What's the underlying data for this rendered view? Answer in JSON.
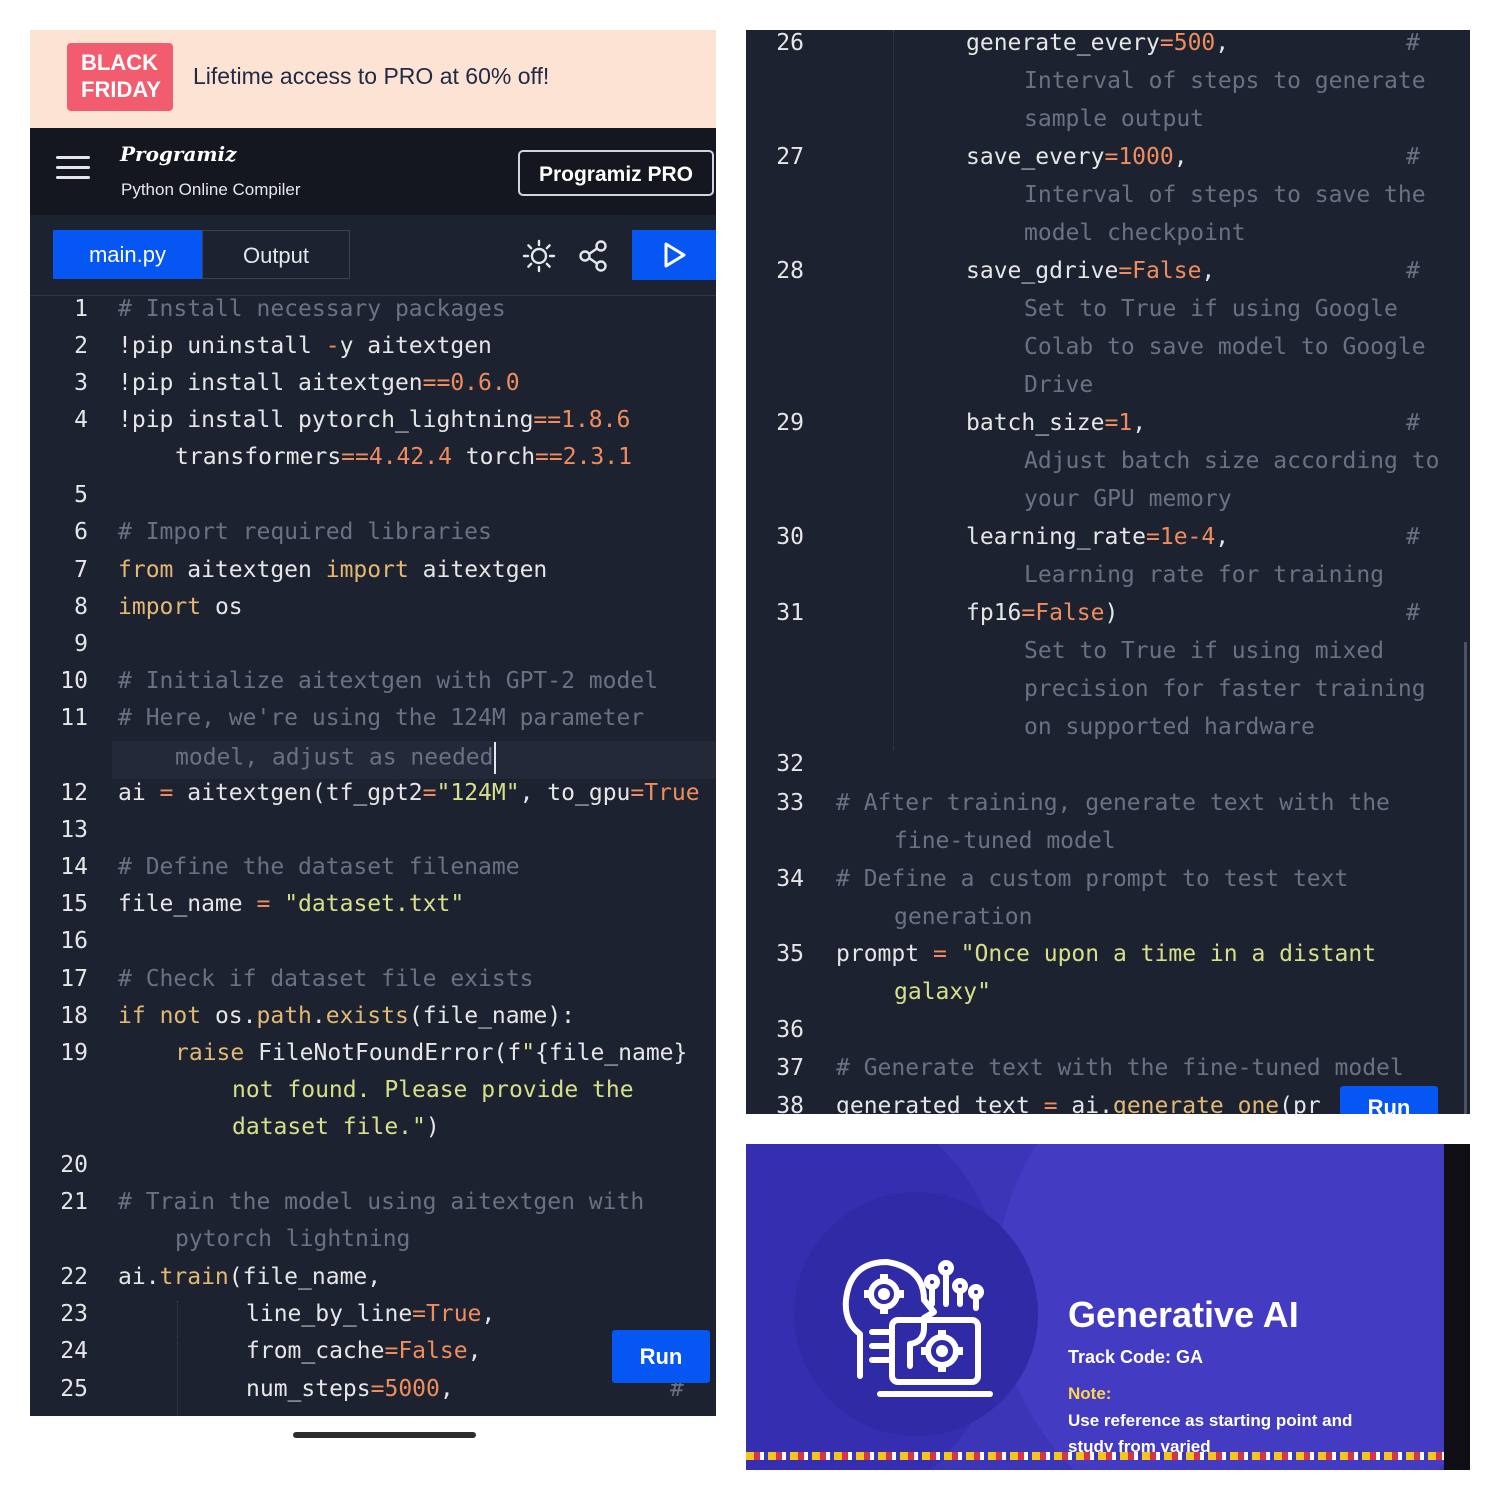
{
  "promo": {
    "badge_line1": "BLACK",
    "badge_line2": "FRIDAY",
    "text": "Lifetime access to PRO at 60% off!"
  },
  "header": {
    "brand": "Programiz",
    "subtitle": "Python Online Compiler",
    "pro_button": "Programiz PRO"
  },
  "tabs": {
    "main": "main.py",
    "output": "Output"
  },
  "icons": {
    "menu": "hamburger-menu-icon",
    "theme": "sun-icon",
    "share": "share-icon",
    "run": "play-icon"
  },
  "left_code": {
    "run_button": "Run",
    "lines": [
      {
        "n": "1",
        "text": "# Install necessary packages"
      },
      {
        "n": "2",
        "text": "!pip uninstall -y aitextgen"
      },
      {
        "n": "3",
        "text": "!pip install aitextgen==0.6.0"
      },
      {
        "n": "4",
        "text": "!pip install pytorch_lightning==1.8.6 transformers==4.42.4 torch==2.3.1"
      },
      {
        "n": "5",
        "text": ""
      },
      {
        "n": "6",
        "text": "# Import required libraries"
      },
      {
        "n": "7",
        "text": "from aitextgen import aitextgen"
      },
      {
        "n": "8",
        "text": "import os"
      },
      {
        "n": "9",
        "text": ""
      },
      {
        "n": "10",
        "text": "# Initialize aitextgen with GPT-2 model"
      },
      {
        "n": "11",
        "text": "# Here, we're using the 124M parameter model, adjust as needed"
      },
      {
        "n": "12",
        "text": "ai = aitextgen(tf_gpt2=\"124M\", to_gpu=True"
      },
      {
        "n": "13",
        "text": ""
      },
      {
        "n": "14",
        "text": "# Define the dataset filename"
      },
      {
        "n": "15",
        "text": "file_name = \"dataset.txt\""
      },
      {
        "n": "16",
        "text": ""
      },
      {
        "n": "17",
        "text": "# Check if dataset file exists"
      },
      {
        "n": "18",
        "text": "if not os.path.exists(file_name):"
      },
      {
        "n": "19",
        "text": "raise FileNotFoundError(f\"{file_name} not found. Please provide the dataset file.\")"
      },
      {
        "n": "20",
        "text": ""
      },
      {
        "n": "21",
        "text": "# Train the model using aitextgen with pytorch lightning"
      },
      {
        "n": "22",
        "text": "ai.train(file_name,"
      },
      {
        "n": "23",
        "text": "line_by_line=True,"
      },
      {
        "n": "24",
        "text": "from_cache=False,"
      },
      {
        "n": "25",
        "text": "num_steps=5000,"
      }
    ]
  },
  "right_code": {
    "run_button": "Run",
    "lines": [
      {
        "n": "26",
        "text": "generate_every=500, # Interval of steps to generate sample output"
      },
      {
        "n": "27",
        "text": "save_every=1000, # Interval of steps to save the model checkpoint"
      },
      {
        "n": "28",
        "text": "save_gdrive=False, # Set to True if using Google Colab to save model to Google Drive"
      },
      {
        "n": "29",
        "text": "batch_size=1, # Adjust batch size according to your GPU memory"
      },
      {
        "n": "30",
        "text": "learning_rate=1e-4, # Learning rate for training"
      },
      {
        "n": "31",
        "text": "fp16=False) # Set to True if using mixed precision for faster training on supported hardware"
      },
      {
        "n": "32",
        "text": ""
      },
      {
        "n": "33",
        "text": "# After training, generate text with the fine-tuned model"
      },
      {
        "n": "34",
        "text": "# Define a custom prompt to test text generation"
      },
      {
        "n": "35",
        "text": "prompt = \"Once upon a time in a distant galaxy\""
      },
      {
        "n": "36",
        "text": ""
      },
      {
        "n": "37",
        "text": "# Generate text with the fine-tuned model"
      },
      {
        "n": "38",
        "text": "generated_text = ai.generate_one(pr"
      }
    ]
  },
  "slide": {
    "title": "Generative AI",
    "track_code": "Track Code: GA",
    "note_label": "Note:",
    "note_text": "Use reference as starting point and study from varied"
  },
  "colors": {
    "editor_bg": "#1d2230",
    "accent_blue": "#0556f3",
    "comment": "#6b7180",
    "keyword": "#e3b872",
    "number": "#f08d5e",
    "string": "#d6e08a",
    "promo_bg": "#fde3d3",
    "badge": "#f15d6f"
  }
}
